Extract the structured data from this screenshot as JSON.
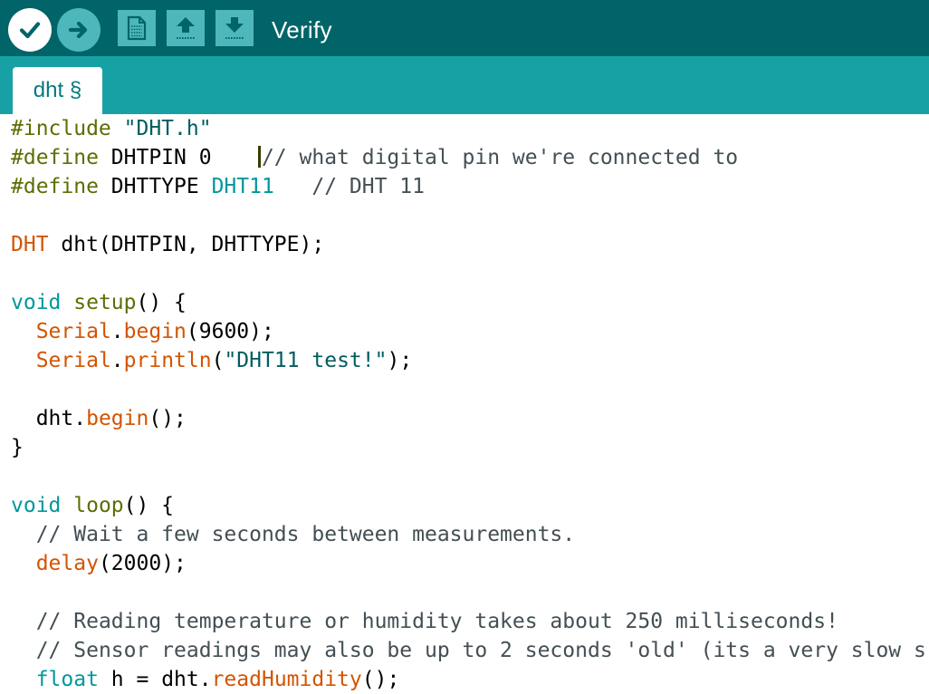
{
  "toolbar": {
    "status_label": "Verify",
    "buttons": [
      {
        "name": "verify-button",
        "icon": "check-icon"
      },
      {
        "name": "upload-button",
        "icon": "arrow-right-icon"
      },
      {
        "name": "new-button",
        "icon": "new-sketch-icon"
      },
      {
        "name": "open-button",
        "icon": "arrow-up-icon"
      },
      {
        "name": "save-button",
        "icon": "arrow-down-icon"
      }
    ]
  },
  "tabs": [
    {
      "label": "dht §",
      "active": true
    }
  ],
  "colors": {
    "toolbar_bg": "#006468",
    "tabbar_bg": "#17a1a5",
    "button_bg": "#4db7bb",
    "keyword": "#00979c",
    "preprocessor": "#5e6d03",
    "type_method": "#d35400",
    "comment": "#434f54"
  },
  "editor": {
    "caret_line": 1,
    "lines": [
      [
        [
          "pre",
          "#include"
        ],
        [
          "plain",
          " "
        ],
        [
          "str",
          "\"DHT.h\""
        ]
      ],
      [
        [
          "pre",
          "#define"
        ],
        [
          "plain",
          " DHTPIN 0    "
        ],
        [
          "caret",
          ""
        ],
        [
          "cmt",
          "// what digital pin we're connected to"
        ]
      ],
      [
        [
          "pre",
          "#define"
        ],
        [
          "plain",
          " DHTTYPE "
        ],
        [
          "kw",
          "DHT11"
        ],
        [
          "plain",
          "   "
        ],
        [
          "cmt",
          "// DHT 11"
        ]
      ],
      [],
      [
        [
          "type",
          "DHT"
        ],
        [
          "plain",
          " dht(DHTPIN, DHTTYPE);"
        ]
      ],
      [],
      [
        [
          "kw",
          "void"
        ],
        [
          "plain",
          " "
        ],
        [
          "fn",
          "setup"
        ],
        [
          "plain",
          "() {"
        ]
      ],
      [
        [
          "plain",
          "  "
        ],
        [
          "type",
          "Serial"
        ],
        [
          "plain",
          "."
        ],
        [
          "type",
          "begin"
        ],
        [
          "plain",
          "(9600);"
        ]
      ],
      [
        [
          "plain",
          "  "
        ],
        [
          "type",
          "Serial"
        ],
        [
          "plain",
          "."
        ],
        [
          "type",
          "println"
        ],
        [
          "plain",
          "("
        ],
        [
          "str",
          "\"DHT11 test!\""
        ],
        [
          "plain",
          ");"
        ]
      ],
      [],
      [
        [
          "plain",
          "  dht."
        ],
        [
          "type",
          "begin"
        ],
        [
          "plain",
          "();"
        ]
      ],
      [
        [
          "plain",
          "}"
        ]
      ],
      [],
      [
        [
          "kw",
          "void"
        ],
        [
          "plain",
          " "
        ],
        [
          "fn",
          "loop"
        ],
        [
          "plain",
          "() {"
        ]
      ],
      [
        [
          "plain",
          "  "
        ],
        [
          "cmt",
          "// Wait a few seconds between measurements."
        ]
      ],
      [
        [
          "plain",
          "  "
        ],
        [
          "type",
          "delay"
        ],
        [
          "plain",
          "(2000);"
        ]
      ],
      [],
      [
        [
          "plain",
          "  "
        ],
        [
          "cmt",
          "// Reading temperature or humidity takes about 250 milliseconds!"
        ]
      ],
      [
        [
          "plain",
          "  "
        ],
        [
          "cmt",
          "// Sensor readings may also be up to 2 seconds 'old' (its a very slow s"
        ]
      ],
      [
        [
          "plain",
          "  "
        ],
        [
          "kw",
          "float"
        ],
        [
          "plain",
          " h = dht."
        ],
        [
          "type",
          "readHumidity"
        ],
        [
          "plain",
          "();"
        ]
      ]
    ]
  }
}
